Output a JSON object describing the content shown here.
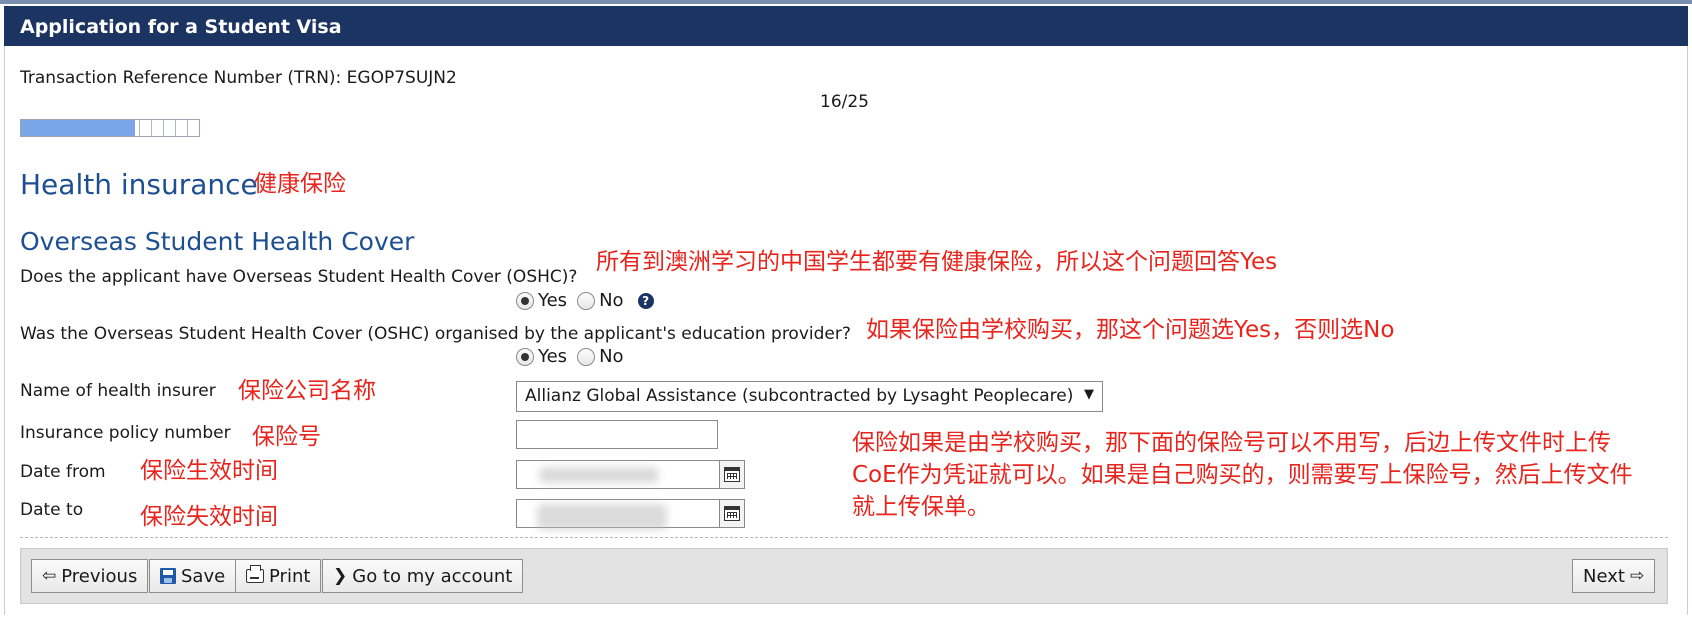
{
  "window": {
    "title": "Application for a Student Visa"
  },
  "header": {
    "trn": "Transaction Reference Number (TRN): EGOP7SUJN2",
    "page_counter": "16/25",
    "progress_fraction": 0.64
  },
  "section": {
    "title": "Health insurance",
    "subtitle": "Overseas Student Health Cover"
  },
  "questions": {
    "has_oshc": {
      "label": "Does the applicant have Overseas Student Health Cover (OSHC)?",
      "yes": "Yes",
      "no": "No",
      "selected": "Yes"
    },
    "organised_by_provider": {
      "label": "Was the Overseas Student Health Cover (OSHC) organised by the applicant's education provider?",
      "yes": "Yes",
      "no": "No",
      "selected": "Yes"
    }
  },
  "fields": {
    "insurer": {
      "label": "Name of health insurer",
      "value": "Allianz Global Assistance (subcontracted by Lysaght Peoplecare)"
    },
    "policy_number": {
      "label": "Insurance policy number",
      "value": ""
    },
    "date_from": {
      "label": "Date from"
    },
    "date_to": {
      "label": "Date to"
    }
  },
  "annotations": {
    "health_insurance": "健康保险",
    "oshc_question": "所有到澳洲学习的中国学生都要有健康保险，所以这个问题回答Yes",
    "provider_question": "如果保险由学校购买，那这个问题选Yes，否则选No",
    "insurer_name": "保险公司名称",
    "policy_number": "保险号",
    "date_from": "保险生效时间",
    "date_to": "保险失效时间",
    "note_line1": "保险如果是由学校购买，那下面的保险号可以不用写，后边上传文件时上传",
    "note_line2": "CoE作为凭证就可以。如果是自己购买的，则需要写上保险号，然后上传文件",
    "note_line3": "就上传保单。"
  },
  "buttons": {
    "previous": "Previous",
    "save": "Save",
    "print": "Print",
    "account": "Go to my account",
    "next": "Next"
  },
  "icons": {
    "previous": "arrow-left-icon",
    "save": "floppy-disk-icon",
    "print": "printer-icon",
    "account": "chevron-right-icon",
    "next": "arrow-right-icon",
    "help": "question-circle-icon",
    "calendar": "calendar-icon"
  },
  "colors": {
    "title_bar": "#1c3461",
    "heading": "#1d4f91",
    "annotation": "#e8241c",
    "progress_fill": "#7aa5e6"
  }
}
